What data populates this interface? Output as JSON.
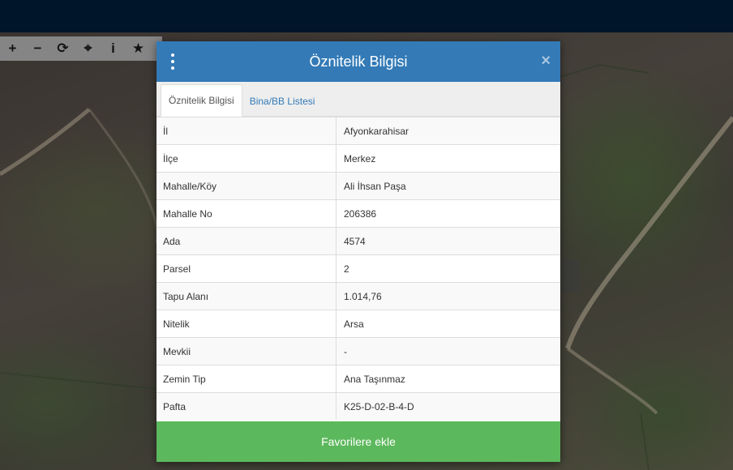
{
  "toolbar": {
    "tools": [
      {
        "glyph": "+",
        "icon": "zoom-in-icon"
      },
      {
        "glyph": "−",
        "icon": "zoom-out-icon"
      },
      {
        "glyph": "⟳",
        "icon": "refresh-icon"
      },
      {
        "glyph": "⌖",
        "icon": "crosshair-icon"
      },
      {
        "glyph": "i",
        "icon": "info-icon"
      },
      {
        "glyph": "★",
        "icon": "star-icon"
      }
    ]
  },
  "dialog": {
    "title": "Öznitelik Bilgisi",
    "close_glyph": "×",
    "tabs": [
      {
        "label": "Öznitelik Bilgisi",
        "active": true
      },
      {
        "label": "Bina/BB Listesi",
        "active": false
      }
    ],
    "rows": [
      {
        "key": "İl",
        "value": "Afyonkarahisar"
      },
      {
        "key": "İlçe",
        "value": "Merkez"
      },
      {
        "key": "Mahalle/Köy",
        "value": "Ali İhsan Paşa"
      },
      {
        "key": "Mahalle No",
        "value": "206386"
      },
      {
        "key": "Ada",
        "value": "4574"
      },
      {
        "key": "Parsel",
        "value": "2"
      },
      {
        "key": "Tapu Alanı",
        "value": "1.014,76"
      },
      {
        "key": "Nitelik",
        "value": "Arsa"
      },
      {
        "key": "Mevkii",
        "value": "-"
      },
      {
        "key": "Zemin Tip",
        "value": "Ana Taşınmaz"
      },
      {
        "key": "Pafta",
        "value": "K25-D-02-B-4-D"
      }
    ],
    "favorite_button": "Favorilere ekle"
  },
  "colors": {
    "topbar": "#00142a",
    "header": "#337ab7",
    "button": "#5cb85c"
  }
}
